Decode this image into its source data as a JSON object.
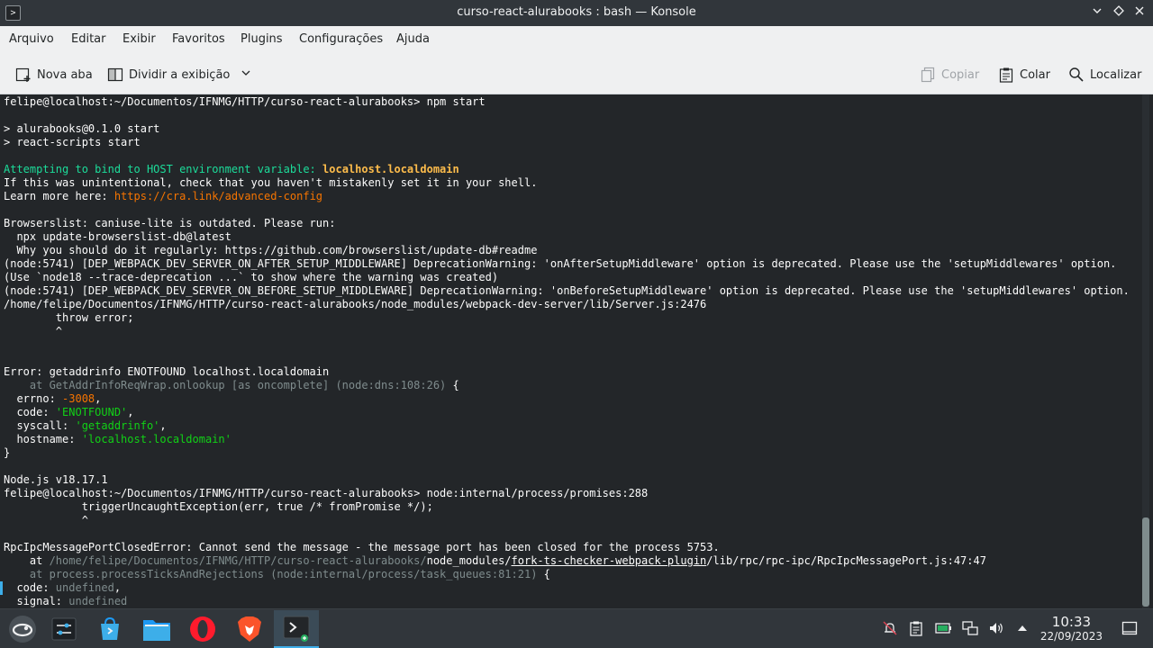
{
  "window": {
    "title": "curso-react-alurabooks : bash — Konsole",
    "app_icon": "terminal-icon",
    "controls": [
      "chevron-down-icon",
      "diamond-icon",
      "close-icon"
    ]
  },
  "menu": {
    "items": [
      "Arquivo",
      "Editar",
      "Exibir",
      "Favoritos",
      "Plugins",
      "Configurações",
      "Ajuda"
    ]
  },
  "toolbar": {
    "new_tab": "Nova aba",
    "split_view": "Dividir a exibição",
    "copy": "Copiar",
    "paste": "Colar",
    "find": "Localizar"
  },
  "terminal": {
    "lines": [
      [
        {
          "t": "felipe@localhost:~/Documentos/IFNMG/HTTP/curso-react-alurabooks> npm start"
        }
      ],
      [
        {
          "t": ""
        }
      ],
      [
        {
          "t": "> alurabooks@0.1.0 start"
        }
      ],
      [
        {
          "t": "> react-scripts start"
        }
      ],
      [
        {
          "t": ""
        }
      ],
      [
        {
          "t": "Attempting to bind to HOST environment variable: ",
          "c": "green"
        },
        {
          "t": "localhost.localdomain",
          "c": "yellow"
        }
      ],
      [
        {
          "t": "If this was unintentional, check that you haven't mistakenly set it in your shell."
        }
      ],
      [
        {
          "t": "Learn more here: "
        },
        {
          "t": "https://cra.link/advanced-config",
          "c": "orange"
        }
      ],
      [
        {
          "t": ""
        }
      ],
      [
        {
          "t": "Browserslist: caniuse-lite is outdated. Please run:"
        }
      ],
      [
        {
          "t": "  npx update-browserslist-db@latest"
        }
      ],
      [
        {
          "t": "  Why you should do it regularly: https://github.com/browserslist/update-db#readme"
        }
      ],
      [
        {
          "t": "(node:5741) [DEP_WEBPACK_DEV_SERVER_ON_AFTER_SETUP_MIDDLEWARE] DeprecationWarning: 'onAfterSetupMiddleware' option is deprecated. Please use the 'setupMiddlewares' option."
        }
      ],
      [
        {
          "t": "(Use `node18 --trace-deprecation ...` to show where the warning was created)"
        }
      ],
      [
        {
          "t": "(node:5741) [DEP_WEBPACK_DEV_SERVER_ON_BEFORE_SETUP_MIDDLEWARE] DeprecationWarning: 'onBeforeSetupMiddleware' option is deprecated. Please use the 'setupMiddlewares' option."
        }
      ],
      [
        {
          "t": "/home/felipe/Documentos/IFNMG/HTTP/curso-react-alurabooks/node_modules/webpack-dev-server/lib/Server.js:2476"
        }
      ],
      [
        {
          "t": "        throw error;"
        }
      ],
      [
        {
          "t": "        ^"
        }
      ],
      [
        {
          "t": ""
        }
      ],
      [
        {
          "t": ""
        }
      ],
      [
        {
          "t": "Error: getaddrinfo ENOTFOUND localhost.localdomain"
        }
      ],
      [
        {
          "t": "    at GetAddrInfoReqWrap.onlookup [as oncomplete] (node:dns:108:26)",
          "c": "gray"
        },
        {
          "t": " {"
        }
      ],
      [
        {
          "t": "  errno: "
        },
        {
          "t": "-3008",
          "c": "num"
        },
        {
          "t": ","
        }
      ],
      [
        {
          "t": "  code: "
        },
        {
          "t": "'ENOTFOUND'",
          "c": "str"
        },
        {
          "t": ","
        }
      ],
      [
        {
          "t": "  syscall: "
        },
        {
          "t": "'getaddrinfo'",
          "c": "str"
        },
        {
          "t": ","
        }
      ],
      [
        {
          "t": "  hostname: "
        },
        {
          "t": "'localhost.localdomain'",
          "c": "str"
        }
      ],
      [
        {
          "t": "}"
        }
      ],
      [
        {
          "t": ""
        }
      ],
      [
        {
          "t": "Node.js v18.17.1"
        }
      ],
      [
        {
          "t": "felipe@localhost:~/Documentos/IFNMG/HTTP/curso-react-alurabooks> node:internal/process/promises:288"
        }
      ],
      [
        {
          "t": "            triggerUncaughtException(err, true /* fromPromise */);"
        }
      ],
      [
        {
          "t": "            ^"
        }
      ],
      [
        {
          "t": ""
        }
      ],
      [
        {
          "t": "RpcIpcMessagePortClosedError: Cannot send the message - the message port has been closed for the process 5753."
        }
      ],
      [
        {
          "t": "    at "
        },
        {
          "t": "/home/felipe/Documentos/IFNMG/HTTP/curso-react-alurabooks/",
          "c": "gray"
        },
        {
          "t": "node_modules/"
        },
        {
          "t": "fork-ts-checker-webpack-plugin",
          "c": "u"
        },
        {
          "t": "/lib/rpc/rpc-ipc/RpcIpcMessagePort.js:47:47"
        }
      ],
      [
        {
          "t": "    at process.processTicksAndRejections (node:internal/process/task_queues:81:21)",
          "c": "gray"
        },
        {
          "t": " {"
        }
      ],
      [
        {
          "t": "  code: "
        },
        {
          "t": "undefined",
          "c": "gray"
        },
        {
          "t": ","
        }
      ],
      [
        {
          "t": "  signal: "
        },
        {
          "t": "undefined",
          "c": "gray"
        }
      ]
    ]
  },
  "taskbar": {
    "launchers": [
      "opensuse-logo-icon",
      "system-settings-icon",
      "discover-store-icon",
      "file-manager-icon",
      "opera-browser-icon",
      "brave-browser-icon",
      "konsole-icon"
    ],
    "tray_icons": [
      "notifications-muted-icon",
      "clipboard-icon",
      "battery-icon",
      "network-icon",
      "volume-icon",
      "expand-tray-icon"
    ],
    "clock": {
      "time": "10:33",
      "date": "22/09/2023"
    },
    "show_desktop": "show-desktop-icon"
  },
  "colors": {
    "terminal_bg": "#232629",
    "terminal_fg": "#fcfcfc",
    "green": "#1cdc9a",
    "yellow": "#fdbc4b",
    "orange": "#f67400",
    "gray": "#7f8c8d",
    "string": "#11d116",
    "accent": "#3daee9"
  }
}
